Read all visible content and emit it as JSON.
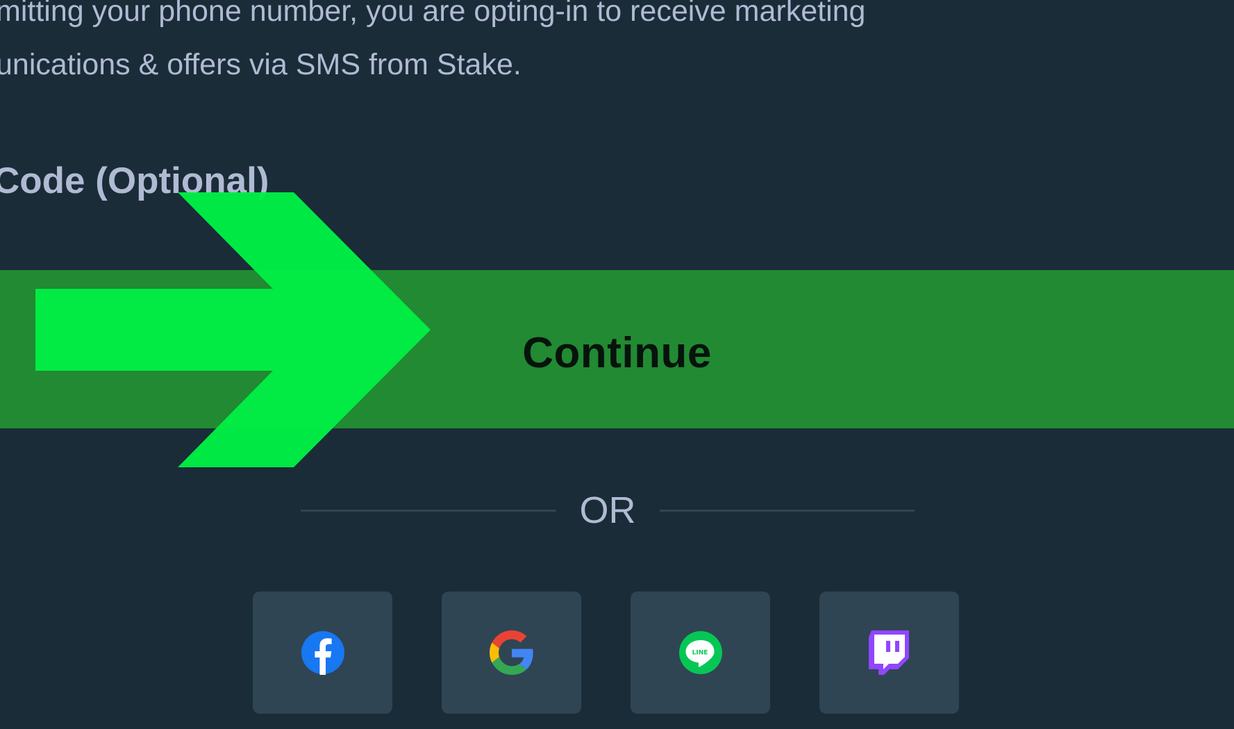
{
  "consent": {
    "line1": "mitting your phone number, you are opting-in to receive marketing",
    "line2": "unications & offers via SMS from Stake."
  },
  "code_label": "Code (Optional)",
  "continue_button": {
    "label": "Continue",
    "color": "#218a32"
  },
  "overlay_arrow": {
    "color": "#00ee45",
    "icon": "right-arrow-icon"
  },
  "divider": {
    "label": "OR"
  },
  "social_login": [
    {
      "name": "facebook",
      "icon": "facebook-icon",
      "color": "#1877f2"
    },
    {
      "name": "google",
      "icon": "google-icon",
      "color": "#4285f4"
    },
    {
      "name": "line",
      "icon": "line-icon",
      "color": "#06c755"
    },
    {
      "name": "twitch",
      "icon": "twitch-icon",
      "color": "#9146ff"
    }
  ],
  "colors": {
    "background": "#1a2c38",
    "text_muted": "#b1bad3",
    "tile": "#2f4553"
  }
}
